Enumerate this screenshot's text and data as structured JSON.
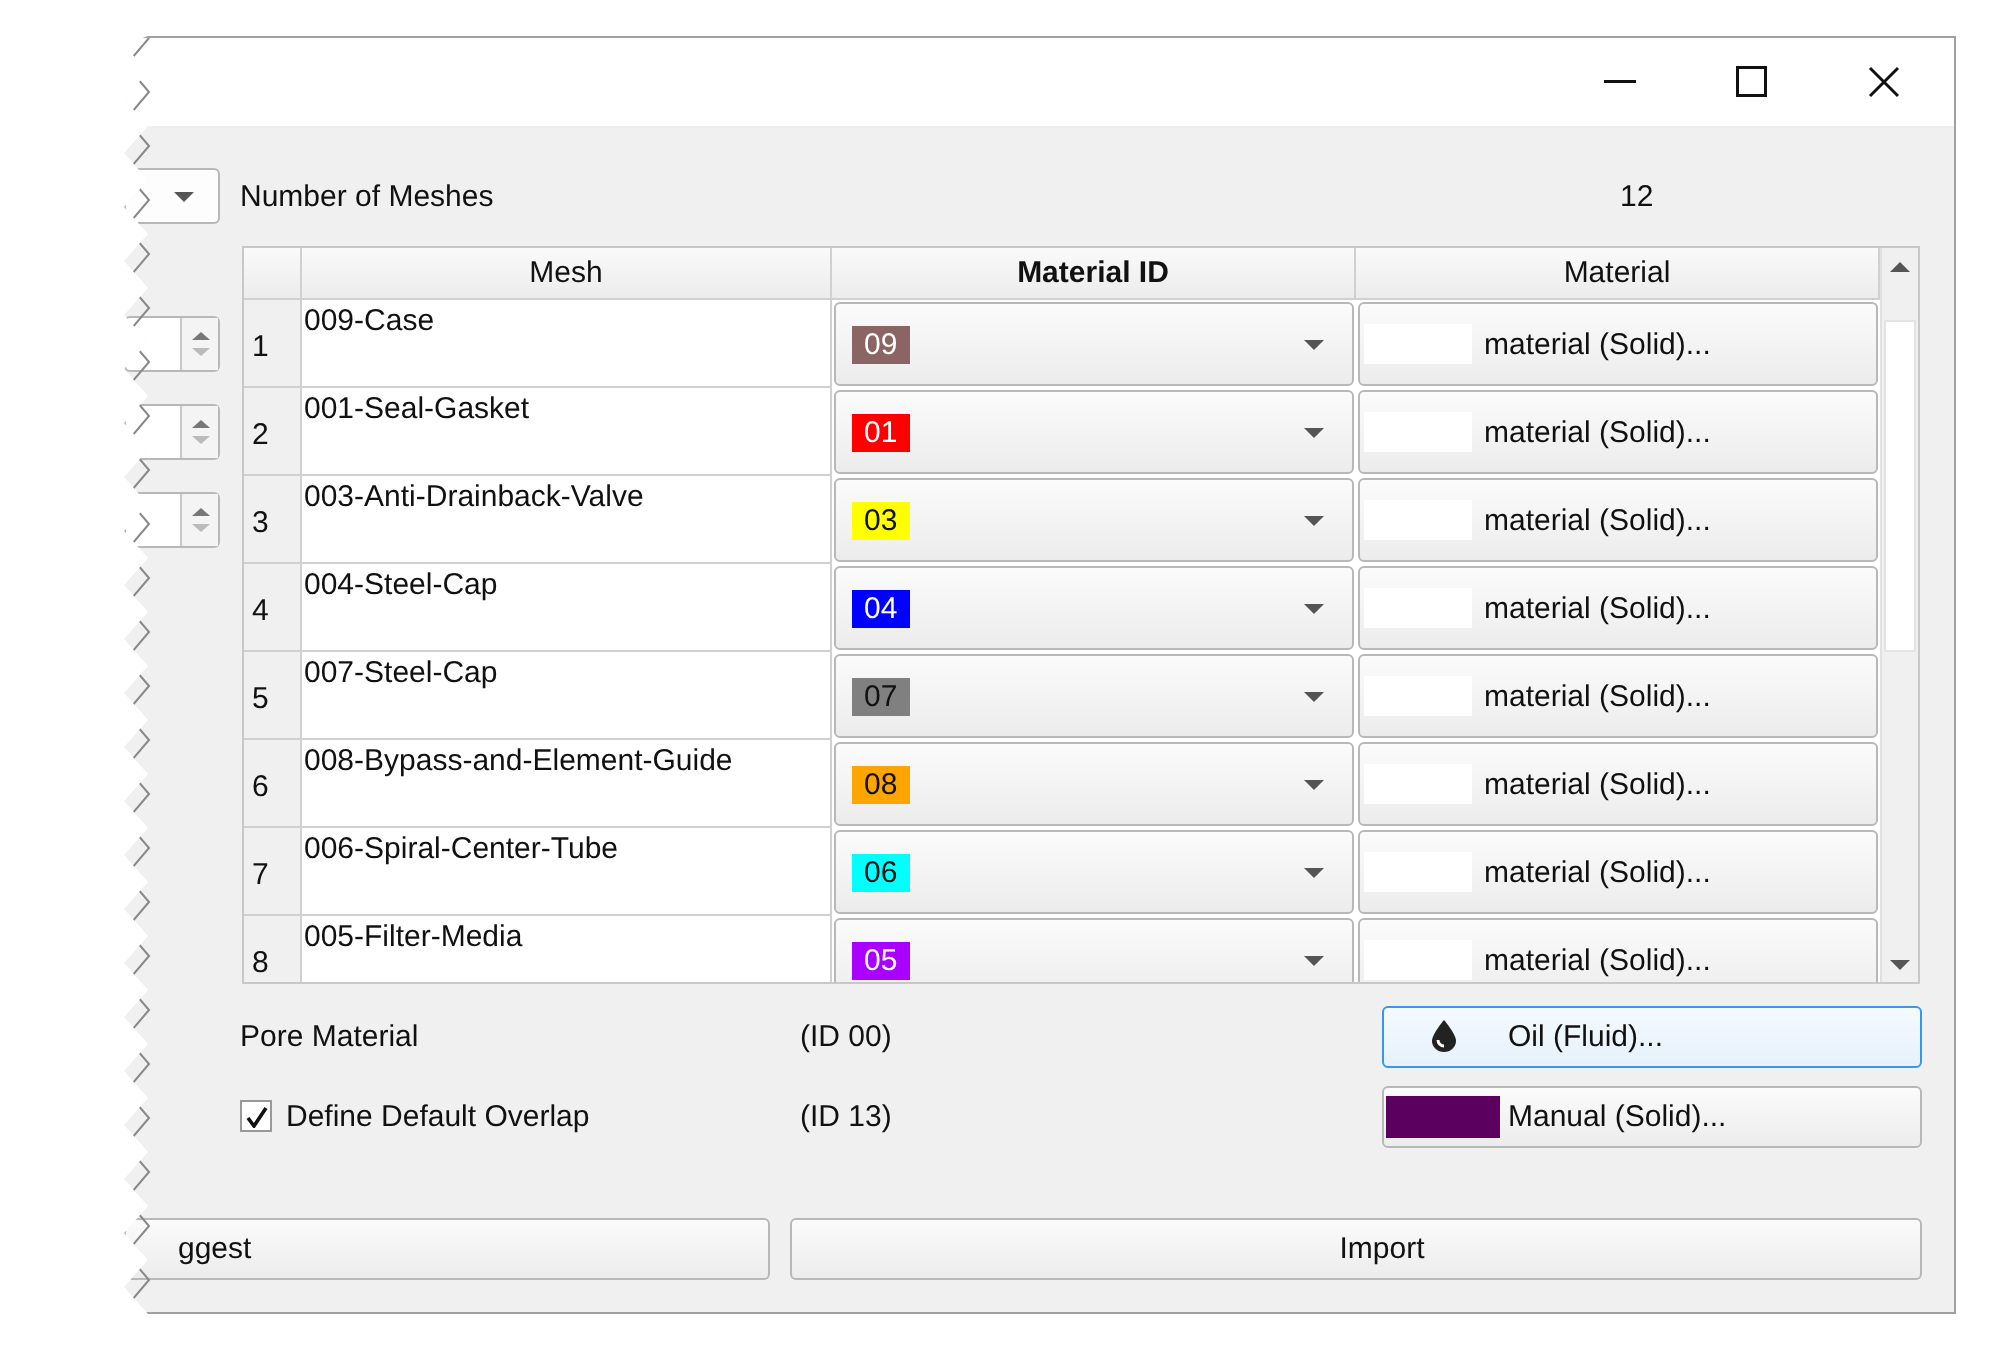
{
  "mesh_count": {
    "label": "Number of Meshes",
    "value": "12"
  },
  "table": {
    "columns": [
      {
        "label": "Mesh",
        "bold": false
      },
      {
        "label": "Material ID",
        "bold": true
      },
      {
        "label": "Material",
        "bold": false
      }
    ],
    "rows": [
      {
        "number": "1",
        "mesh": "009-Case",
        "material_id": "09",
        "color": "#8b6464",
        "material": "material (Solid)...",
        "spinbox": true
      },
      {
        "number": "2",
        "mesh": "001-Seal-Gasket",
        "material_id": "01",
        "color": "#ff0000",
        "material": "material (Solid)...",
        "spinbox": true
      },
      {
        "number": "3",
        "mesh": "003-Anti-Drainback-Valve",
        "material_id": "03",
        "color": "#ffff00",
        "material": "material (Solid)...",
        "spinbox": true
      },
      {
        "number": "4",
        "mesh": "004-Steel-Cap",
        "material_id": "04",
        "color": "#0000ff",
        "material": "material (Solid)...",
        "spinbox": false
      },
      {
        "number": "5",
        "mesh": "007-Steel-Cap",
        "material_id": "07",
        "color": "#808080",
        "material": "material (Solid)...",
        "spinbox": false
      },
      {
        "number": "6",
        "mesh": "008-Bypass-and-Element-Guide",
        "material_id": "08",
        "color": "#ffa500",
        "material": "material (Solid)...",
        "spinbox": false
      },
      {
        "number": "7",
        "mesh": "006-Spiral-Center-Tube",
        "material_id": "06",
        "color": "#00ffff",
        "material": "material (Solid)...",
        "spinbox": false
      },
      {
        "number": "8",
        "mesh": "005-Filter-Media",
        "material_id": "05",
        "color": "#aa00ff",
        "material": "material (Solid)...",
        "spinbox": false
      }
    ]
  },
  "pore_material": {
    "label": "Pore Material",
    "id": "(ID 00)",
    "button": "Oil (Fluid)...",
    "focused": true
  },
  "default_overlap": {
    "label": "Define Default Overlap",
    "checked": true,
    "id": "(ID 13)",
    "button": "Manual (Solid)...",
    "color": "#5c0060"
  },
  "buttons": [
    "ggest",
    "Import"
  ]
}
